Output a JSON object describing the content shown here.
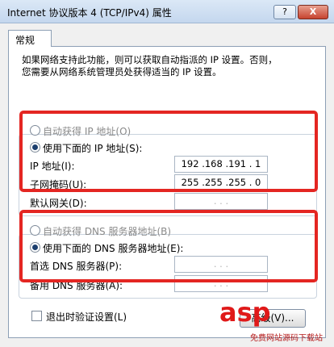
{
  "window": {
    "title": "Internet 协议版本 4 (TCP/IPv4) 属性",
    "help_button": "?",
    "close_button": "X"
  },
  "tab": {
    "label": "常规"
  },
  "description": {
    "line1": "如果网络支持此功能，则可以获取自动指派的 IP 设置。否则，",
    "line2": "您需要从网络系统管理员处获得适当的 IP 设置。"
  },
  "ip_section": {
    "auto_label": "自动获得 IP 地址(O)",
    "manual_label": "使用下面的 IP 地址(S):",
    "ip_label": "IP 地址(I):",
    "ip_value": "192 .168 .191 . 1",
    "mask_label": "子网掩码(U):",
    "mask_value": "255 .255 .255 . 0",
    "gateway_label": "默认网关(D):",
    "gateway_value": ". . ."
  },
  "dns_section": {
    "auto_label": "自动获得 DNS 服务器地址(B)",
    "manual_label": "使用下面的 DNS 服务器地址(E):",
    "preferred_label": "首选 DNS 服务器(P):",
    "preferred_value": ". . .",
    "alternate_label": "备用 DNS 服务器(A):",
    "alternate_value": ". . ."
  },
  "validate_on_exit": {
    "label": "退出时验证设置(L)"
  },
  "advanced_button": {
    "label": "高级(V)..."
  },
  "watermark": {
    "main": "asp",
    "sub": "免费网站源码下载站"
  },
  "colors": {
    "annotation_red": "#e42622"
  }
}
